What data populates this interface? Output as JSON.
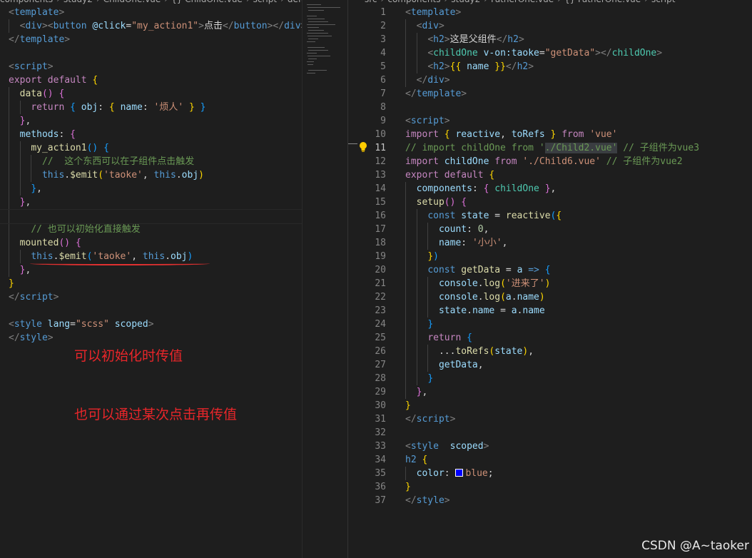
{
  "left_editor": {
    "breadcrumb": [
      "components",
      "study2",
      "ChildOne.vue",
      "{} ChildOne.vue",
      "script",
      "default"
    ],
    "lines": [
      [
        [
          "t-punc",
          "<"
        ],
        [
          "t-tag",
          "template"
        ],
        [
          "t-punc",
          ">"
        ]
      ],
      [
        [
          "t-txt",
          "  "
        ],
        [
          "t-punc",
          "<"
        ],
        [
          "t-tag",
          "div"
        ],
        [
          "t-punc",
          "><"
        ],
        [
          "t-tag",
          "button"
        ],
        [
          "t-txt",
          " "
        ],
        [
          "t-attr",
          "@click"
        ],
        [
          "t-txt",
          "="
        ],
        [
          "t-str",
          "\"my_action1\""
        ],
        [
          "t-punc",
          ">"
        ],
        [
          "t-txt",
          "点击"
        ],
        [
          "t-punc",
          "</"
        ],
        [
          "t-tag",
          "button"
        ],
        [
          "t-punc",
          "></"
        ],
        [
          "t-tag",
          "div"
        ],
        [
          "t-punc",
          ">"
        ]
      ],
      [
        [
          "t-punc",
          "</"
        ],
        [
          "t-tag",
          "template"
        ],
        [
          "t-punc",
          ">"
        ]
      ],
      [],
      [
        [
          "t-punc",
          "<"
        ],
        [
          "t-tag",
          "script"
        ],
        [
          "t-punc",
          ">"
        ]
      ],
      [
        [
          "t-ctrl",
          "export"
        ],
        [
          "t-txt",
          " "
        ],
        [
          "t-ctrl",
          "default"
        ],
        [
          "t-txt",
          " "
        ],
        [
          "t-br1",
          "{"
        ]
      ],
      [
        [
          "t-txt",
          "  "
        ],
        [
          "t-fn",
          "data"
        ],
        [
          "t-br2",
          "()"
        ],
        [
          "t-txt",
          " "
        ],
        [
          "t-br2",
          "{"
        ]
      ],
      [
        [
          "t-txt",
          "    "
        ],
        [
          "t-ctrl",
          "return"
        ],
        [
          "t-txt",
          " "
        ],
        [
          "t-br3",
          "{"
        ],
        [
          "t-txt",
          " "
        ],
        [
          "t-var",
          "obj"
        ],
        [
          "t-txt",
          ": "
        ],
        [
          "t-br1",
          "{"
        ],
        [
          "t-txt",
          " "
        ],
        [
          "t-var",
          "name"
        ],
        [
          "t-txt",
          ": "
        ],
        [
          "t-str",
          "'烦人'"
        ],
        [
          "t-txt",
          " "
        ],
        [
          "t-br1",
          "}"
        ],
        [
          "t-txt",
          " "
        ],
        [
          "t-br3",
          "}"
        ]
      ],
      [
        [
          "t-txt",
          "  "
        ],
        [
          "t-br2",
          "}"
        ],
        [
          "t-txt",
          ","
        ]
      ],
      [
        [
          "t-txt",
          "  "
        ],
        [
          "t-var",
          "methods"
        ],
        [
          "t-txt",
          ": "
        ],
        [
          "t-br2",
          "{"
        ]
      ],
      [
        [
          "t-txt",
          "    "
        ],
        [
          "t-fn",
          "my_action1"
        ],
        [
          "t-br3",
          "()"
        ],
        [
          "t-txt",
          " "
        ],
        [
          "t-br3",
          "{"
        ]
      ],
      [
        [
          "t-txt",
          "      "
        ],
        [
          "t-com",
          "//  这个东西可以在子组件点击触发"
        ]
      ],
      [
        [
          "t-txt",
          "      "
        ],
        [
          "t-kw",
          "this"
        ],
        [
          "t-txt",
          "."
        ],
        [
          "t-fn",
          "$emit"
        ],
        [
          "t-br1",
          "("
        ],
        [
          "t-str",
          "'taoke'"
        ],
        [
          "t-txt",
          ", "
        ],
        [
          "t-kw",
          "this"
        ],
        [
          "t-txt",
          "."
        ],
        [
          "t-var",
          "obj"
        ],
        [
          "t-br1",
          ")"
        ]
      ],
      [
        [
          "t-txt",
          "    "
        ],
        [
          "t-br3",
          "}"
        ],
        [
          "t-txt",
          ","
        ]
      ],
      [
        [
          "t-txt",
          "  "
        ],
        [
          "t-br2",
          "}"
        ],
        [
          "t-txt",
          ","
        ]
      ],
      [],
      [
        [
          "t-txt",
          "    "
        ],
        [
          "t-com",
          "// 也可以初始化直接触发"
        ]
      ],
      [
        [
          "t-txt",
          "  "
        ],
        [
          "t-fn",
          "mounted"
        ],
        [
          "t-br2",
          "()"
        ],
        [
          "t-txt",
          " "
        ],
        [
          "t-br2",
          "{"
        ]
      ],
      [
        [
          "t-txt",
          "    "
        ],
        [
          "t-kw",
          "this"
        ],
        [
          "t-txt",
          "."
        ],
        [
          "t-fn",
          "$emit"
        ],
        [
          "t-br3",
          "("
        ],
        [
          "t-str",
          "'taoke'"
        ],
        [
          "t-txt",
          ", "
        ],
        [
          "t-kw",
          "this"
        ],
        [
          "t-txt",
          "."
        ],
        [
          "t-var",
          "obj"
        ],
        [
          "t-br3",
          ")"
        ]
      ],
      [
        [
          "t-txt",
          "  "
        ],
        [
          "t-br2",
          "}"
        ],
        [
          "t-txt",
          ","
        ]
      ],
      [
        [
          "t-br1",
          "}"
        ]
      ],
      [
        [
          "t-punc",
          "</"
        ],
        [
          "t-tag",
          "script"
        ],
        [
          "t-punc",
          ">"
        ]
      ],
      [],
      [
        [
          "t-punc",
          "<"
        ],
        [
          "t-tag",
          "style"
        ],
        [
          "t-txt",
          " "
        ],
        [
          "t-attr",
          "lang"
        ],
        [
          "t-txt",
          "="
        ],
        [
          "t-str",
          "\"scss\""
        ],
        [
          "t-txt",
          " "
        ],
        [
          "t-attr",
          "scoped"
        ],
        [
          "t-punc",
          ">"
        ]
      ],
      [
        [
          "t-punc",
          "</"
        ],
        [
          "t-tag",
          "style"
        ],
        [
          "t-punc",
          ">"
        ]
      ]
    ],
    "annotations": [
      "可以初始化时传值",
      "也可以通过某次点击再传值"
    ]
  },
  "right_editor": {
    "breadcrumb": [
      "src",
      "components",
      "study2",
      "FatherOne.vue",
      "{} FatherOne.vue",
      "script"
    ],
    "active_line": 11,
    "line_numbers": [
      "1",
      "2",
      "3",
      "4",
      "5",
      "6",
      "7",
      "8",
      "9",
      "10",
      "11",
      "12",
      "13",
      "14",
      "15",
      "16",
      "17",
      "18",
      "19",
      "20",
      "21",
      "22",
      "23",
      "24",
      "25",
      "26",
      "27",
      "28",
      "29",
      "30",
      "31",
      "32",
      "33",
      "34",
      "35",
      "36",
      "37"
    ],
    "lines": [
      [
        [
          "t-punc",
          "<"
        ],
        [
          "t-tag",
          "template"
        ],
        [
          "t-punc",
          ">"
        ]
      ],
      [
        [
          "t-txt",
          "  "
        ],
        [
          "t-punc",
          "<"
        ],
        [
          "t-tag",
          "div"
        ],
        [
          "t-punc",
          ">"
        ]
      ],
      [
        [
          "t-txt",
          "    "
        ],
        [
          "t-punc",
          "<"
        ],
        [
          "t-tag",
          "h2"
        ],
        [
          "t-punc",
          ">"
        ],
        [
          "t-txt",
          "这是父组件"
        ],
        [
          "t-punc",
          "</"
        ],
        [
          "t-tag",
          "h2"
        ],
        [
          "t-punc",
          ">"
        ]
      ],
      [
        [
          "t-txt",
          "    "
        ],
        [
          "t-punc",
          "<"
        ],
        [
          "t-comp",
          "childOne"
        ],
        [
          "t-txt",
          " "
        ],
        [
          "t-attr",
          "v-on:taoke"
        ],
        [
          "t-txt",
          "="
        ],
        [
          "t-str",
          "\"getData\""
        ],
        [
          "t-punc",
          "></"
        ],
        [
          "t-comp",
          "childOne"
        ],
        [
          "t-punc",
          ">"
        ]
      ],
      [
        [
          "t-txt",
          "    "
        ],
        [
          "t-punc",
          "<"
        ],
        [
          "t-tag",
          "h2"
        ],
        [
          "t-punc",
          ">"
        ],
        [
          "t-br1",
          "{{"
        ],
        [
          "t-txt",
          " "
        ],
        [
          "t-var",
          "name"
        ],
        [
          "t-txt",
          " "
        ],
        [
          "t-br1",
          "}}"
        ],
        [
          "t-punc",
          "</"
        ],
        [
          "t-tag",
          "h2"
        ],
        [
          "t-punc",
          ">"
        ]
      ],
      [
        [
          "t-txt",
          "  "
        ],
        [
          "t-punc",
          "</"
        ],
        [
          "t-tag",
          "div"
        ],
        [
          "t-punc",
          ">"
        ]
      ],
      [
        [
          "t-punc",
          "</"
        ],
        [
          "t-tag",
          "template"
        ],
        [
          "t-punc",
          ">"
        ]
      ],
      [],
      [
        [
          "t-punc",
          "<"
        ],
        [
          "t-tag",
          "script"
        ],
        [
          "t-punc",
          ">"
        ]
      ],
      [
        [
          "t-ctrl",
          "import"
        ],
        [
          "t-txt",
          " "
        ],
        [
          "t-br1",
          "{"
        ],
        [
          "t-txt",
          " "
        ],
        [
          "t-var",
          "reactive"
        ],
        [
          "t-txt",
          ", "
        ],
        [
          "t-var",
          "toRefs"
        ],
        [
          "t-txt",
          " "
        ],
        [
          "t-br1",
          "}"
        ],
        [
          "t-txt",
          " "
        ],
        [
          "t-ctrl",
          "from"
        ],
        [
          "t-txt",
          " "
        ],
        [
          "t-str",
          "'vue'"
        ]
      ],
      [
        [
          "t-com",
          "// import childOne from '"
        ],
        [
          "t-com sel-hl",
          "./Child2.vue'"
        ],
        [
          "t-com",
          " // 子组件为vue3"
        ]
      ],
      [
        [
          "t-ctrl",
          "import"
        ],
        [
          "t-txt",
          " "
        ],
        [
          "t-var",
          "childOne"
        ],
        [
          "t-txt",
          " "
        ],
        [
          "t-ctrl",
          "from"
        ],
        [
          "t-txt",
          " "
        ],
        [
          "t-str",
          "'./Child6.vue'"
        ],
        [
          "t-txt",
          " "
        ],
        [
          "t-com",
          "// 子组件为vue2"
        ]
      ],
      [
        [
          "t-ctrl",
          "export"
        ],
        [
          "t-txt",
          " "
        ],
        [
          "t-ctrl",
          "default"
        ],
        [
          "t-txt",
          " "
        ],
        [
          "t-br1",
          "{"
        ]
      ],
      [
        [
          "t-txt",
          "  "
        ],
        [
          "t-var",
          "components"
        ],
        [
          "t-txt",
          ": "
        ],
        [
          "t-br2",
          "{"
        ],
        [
          "t-txt",
          " "
        ],
        [
          "t-comp",
          "childOne"
        ],
        [
          "t-txt",
          " "
        ],
        [
          "t-br2",
          "}"
        ],
        [
          "t-txt",
          ","
        ]
      ],
      [
        [
          "t-txt",
          "  "
        ],
        [
          "t-fn",
          "setup"
        ],
        [
          "t-br2",
          "()"
        ],
        [
          "t-txt",
          " "
        ],
        [
          "t-br2",
          "{"
        ]
      ],
      [
        [
          "t-txt",
          "    "
        ],
        [
          "t-kw",
          "const"
        ],
        [
          "t-txt",
          " "
        ],
        [
          "t-var",
          "state"
        ],
        [
          "t-txt",
          " = "
        ],
        [
          "t-fn",
          "reactive"
        ],
        [
          "t-br3",
          "("
        ],
        [
          "t-br1",
          "{"
        ]
      ],
      [
        [
          "t-txt",
          "      "
        ],
        [
          "t-var",
          "count"
        ],
        [
          "t-txt",
          ": "
        ],
        [
          "t-num",
          "0"
        ],
        [
          "t-txt",
          ","
        ]
      ],
      [
        [
          "t-txt",
          "      "
        ],
        [
          "t-var",
          "name"
        ],
        [
          "t-txt",
          ": "
        ],
        [
          "t-str",
          "'小小'"
        ],
        [
          "t-txt",
          ","
        ]
      ],
      [
        [
          "t-txt",
          "    "
        ],
        [
          "t-br1",
          "}"
        ],
        [
          "t-br3",
          ")"
        ]
      ],
      [
        [
          "t-txt",
          "    "
        ],
        [
          "t-kw",
          "const"
        ],
        [
          "t-txt",
          " "
        ],
        [
          "t-fn",
          "getData"
        ],
        [
          "t-txt",
          " = "
        ],
        [
          "t-var",
          "a"
        ],
        [
          "t-txt",
          " "
        ],
        [
          "t-kw",
          "=>"
        ],
        [
          "t-txt",
          " "
        ],
        [
          "t-br3",
          "{"
        ]
      ],
      [
        [
          "t-txt",
          "      "
        ],
        [
          "t-var",
          "console"
        ],
        [
          "t-txt",
          "."
        ],
        [
          "t-fn",
          "log"
        ],
        [
          "t-br1",
          "("
        ],
        [
          "t-str",
          "'进来了'"
        ],
        [
          "t-br1",
          ")"
        ]
      ],
      [
        [
          "t-txt",
          "      "
        ],
        [
          "t-var",
          "console"
        ],
        [
          "t-txt",
          "."
        ],
        [
          "t-fn",
          "log"
        ],
        [
          "t-br1",
          "("
        ],
        [
          "t-var",
          "a"
        ],
        [
          "t-txt",
          "."
        ],
        [
          "t-var",
          "name"
        ],
        [
          "t-br1",
          ")"
        ]
      ],
      [
        [
          "t-txt",
          "      "
        ],
        [
          "t-var",
          "state"
        ],
        [
          "t-txt",
          "."
        ],
        [
          "t-var",
          "name"
        ],
        [
          "t-txt",
          " = "
        ],
        [
          "t-var",
          "a"
        ],
        [
          "t-txt",
          "."
        ],
        [
          "t-var",
          "name"
        ]
      ],
      [
        [
          "t-txt",
          "    "
        ],
        [
          "t-br3",
          "}"
        ]
      ],
      [
        [
          "t-txt",
          "    "
        ],
        [
          "t-ctrl",
          "return"
        ],
        [
          "t-txt",
          " "
        ],
        [
          "t-br3",
          "{"
        ]
      ],
      [
        [
          "t-txt",
          "      ..."
        ],
        [
          "t-fn",
          "toRefs"
        ],
        [
          "t-br1",
          "("
        ],
        [
          "t-var",
          "state"
        ],
        [
          "t-br1",
          ")"
        ],
        [
          "t-txt",
          ","
        ]
      ],
      [
        [
          "t-txt",
          "      "
        ],
        [
          "t-var",
          "getData"
        ],
        [
          "t-txt",
          ","
        ]
      ],
      [
        [
          "t-txt",
          "    "
        ],
        [
          "t-br3",
          "}"
        ]
      ],
      [
        [
          "t-txt",
          "  "
        ],
        [
          "t-br2",
          "}"
        ],
        [
          "t-txt",
          ","
        ]
      ],
      [
        [
          "t-br1",
          "}"
        ]
      ],
      [
        [
          "t-punc",
          "</"
        ],
        [
          "t-tag",
          "script"
        ],
        [
          "t-punc",
          ">"
        ]
      ],
      [],
      [
        [
          "t-punc",
          "<"
        ],
        [
          "t-tag",
          "style"
        ],
        [
          "t-txt",
          "  "
        ],
        [
          "t-attr",
          "scoped"
        ],
        [
          "t-punc",
          ">"
        ]
      ],
      [
        [
          "t-tag",
          "h2"
        ],
        [
          "t-txt",
          " "
        ],
        [
          "t-br1",
          "{"
        ]
      ],
      [
        [
          "t-txt",
          "  "
        ],
        [
          "t-attr",
          "color"
        ],
        [
          "t-txt",
          ": "
        ],
        [
          "swatch",
          ""
        ],
        [
          "t-str",
          "blue"
        ],
        [
          "t-txt",
          ";"
        ]
      ],
      [
        [
          "t-br1",
          "}"
        ]
      ],
      [
        [
          "t-punc",
          "</"
        ],
        [
          "t-tag",
          "style"
        ],
        [
          "t-punc",
          ">"
        ]
      ]
    ]
  },
  "colors": {
    "background": "#1e1e1e",
    "annotation_red": "#e8262a",
    "swatch_blue": "#0000ff"
  },
  "watermark": "CSDN @A~taoker"
}
